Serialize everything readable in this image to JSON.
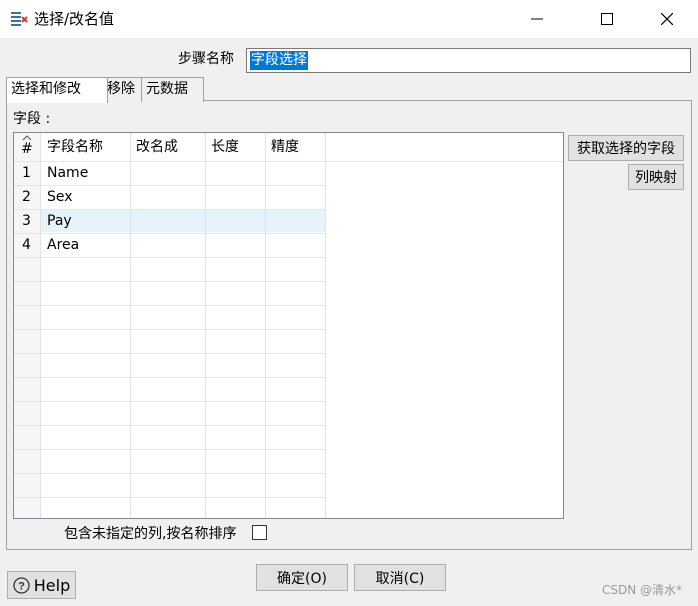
{
  "window": {
    "title": "选择/改名值"
  },
  "step": {
    "label": "步骤名称",
    "value": "字段选择"
  },
  "tabs": [
    {
      "label": "选择和修改",
      "active": true
    },
    {
      "label": "移除",
      "active": false
    },
    {
      "label": "元数据",
      "active": false
    }
  ],
  "fields": {
    "label": "字段 :",
    "columns": [
      "#",
      "字段名称",
      "改名成",
      "长度",
      "精度"
    ],
    "rows": [
      {
        "num": "1",
        "name": "Name",
        "rename": "",
        "length": "",
        "precision": ""
      },
      {
        "num": "2",
        "name": "Sex",
        "rename": "",
        "length": "",
        "precision": ""
      },
      {
        "num": "3",
        "name": "Pay",
        "rename": "",
        "length": "",
        "precision": ""
      },
      {
        "num": "4",
        "name": "Area",
        "rename": "",
        "length": "",
        "precision": ""
      }
    ],
    "selected_row": 3
  },
  "buttons": {
    "get_selected": "获取选择的字段",
    "column_mapping": "列映射",
    "ok": "确定(O)",
    "cancel": "取消(C)",
    "help": "Help"
  },
  "options": {
    "include_unspecified": "包含未指定的列,按名称排序",
    "include_unspecified_checked": false
  },
  "watermark": "CSDN @清水*",
  "colors": {
    "selection": "#0078d7",
    "selected_row": "#e5f3fd",
    "background": "#f0f0f0"
  }
}
